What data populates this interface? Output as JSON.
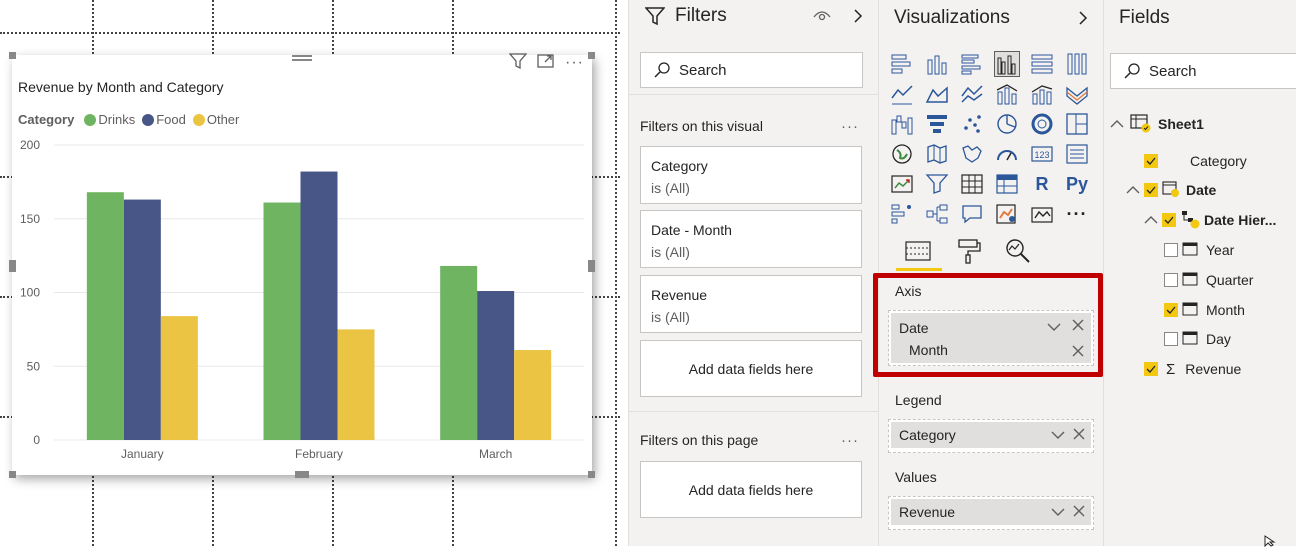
{
  "canvas": {
    "visual": {
      "title": "Revenue by Month and Category",
      "legend_title": "Category",
      "legend": [
        {
          "name": "Drinks",
          "color": "#6fb561"
        },
        {
          "name": "Food",
          "color": "#475686"
        },
        {
          "name": "Other",
          "color": "#ebc444"
        }
      ]
    }
  },
  "chart_data": {
    "type": "bar",
    "title": "Revenue by Month and Category",
    "categories": [
      "January",
      "February",
      "March"
    ],
    "series": [
      {
        "name": "Drinks",
        "color": "#6fb561",
        "values": [
          168,
          161,
          118
        ]
      },
      {
        "name": "Food",
        "color": "#475686",
        "values": [
          163,
          182,
          101
        ]
      },
      {
        "name": "Other",
        "color": "#ebc444",
        "values": [
          84,
          75,
          61
        ]
      }
    ],
    "yticks": [
      0,
      50,
      100,
      150,
      200
    ],
    "ylim": [
      0,
      200
    ],
    "legend_position": "top-left",
    "grid": true
  },
  "filters": {
    "title": "Filters",
    "search_placeholder": "Search",
    "on_visual_label": "Filters on this visual",
    "cards": [
      {
        "field": "Category",
        "state": "is (All)"
      },
      {
        "field": "Date - Month",
        "state": "is (All)"
      },
      {
        "field": "Revenue",
        "state": "is (All)"
      }
    ],
    "add_fields": "Add data fields here",
    "on_page_label": "Filters on this page",
    "add_fields_page": "Add data fields here",
    "ellipsis": "···"
  },
  "visualizations": {
    "title": "Visualizations",
    "r_label": "R",
    "py_label": "Py",
    "more": "···",
    "axis_label": "Axis",
    "axis_field": "Date",
    "axis_sub": "Month",
    "legend_label": "Legend",
    "legend_field": "Category",
    "values_label": "Values",
    "values_field": "Revenue"
  },
  "fields": {
    "title": "Fields",
    "search_placeholder": "Search",
    "table": "Sheet1",
    "items": {
      "category": "Category",
      "date": "Date",
      "hierarchy": "Date Hier...",
      "year": "Year",
      "quarter": "Quarter",
      "month": "Month",
      "day": "Day",
      "revenue": "Revenue"
    }
  },
  "colors": {
    "accent": "#f2c811",
    "highlight": "#c00000"
  }
}
